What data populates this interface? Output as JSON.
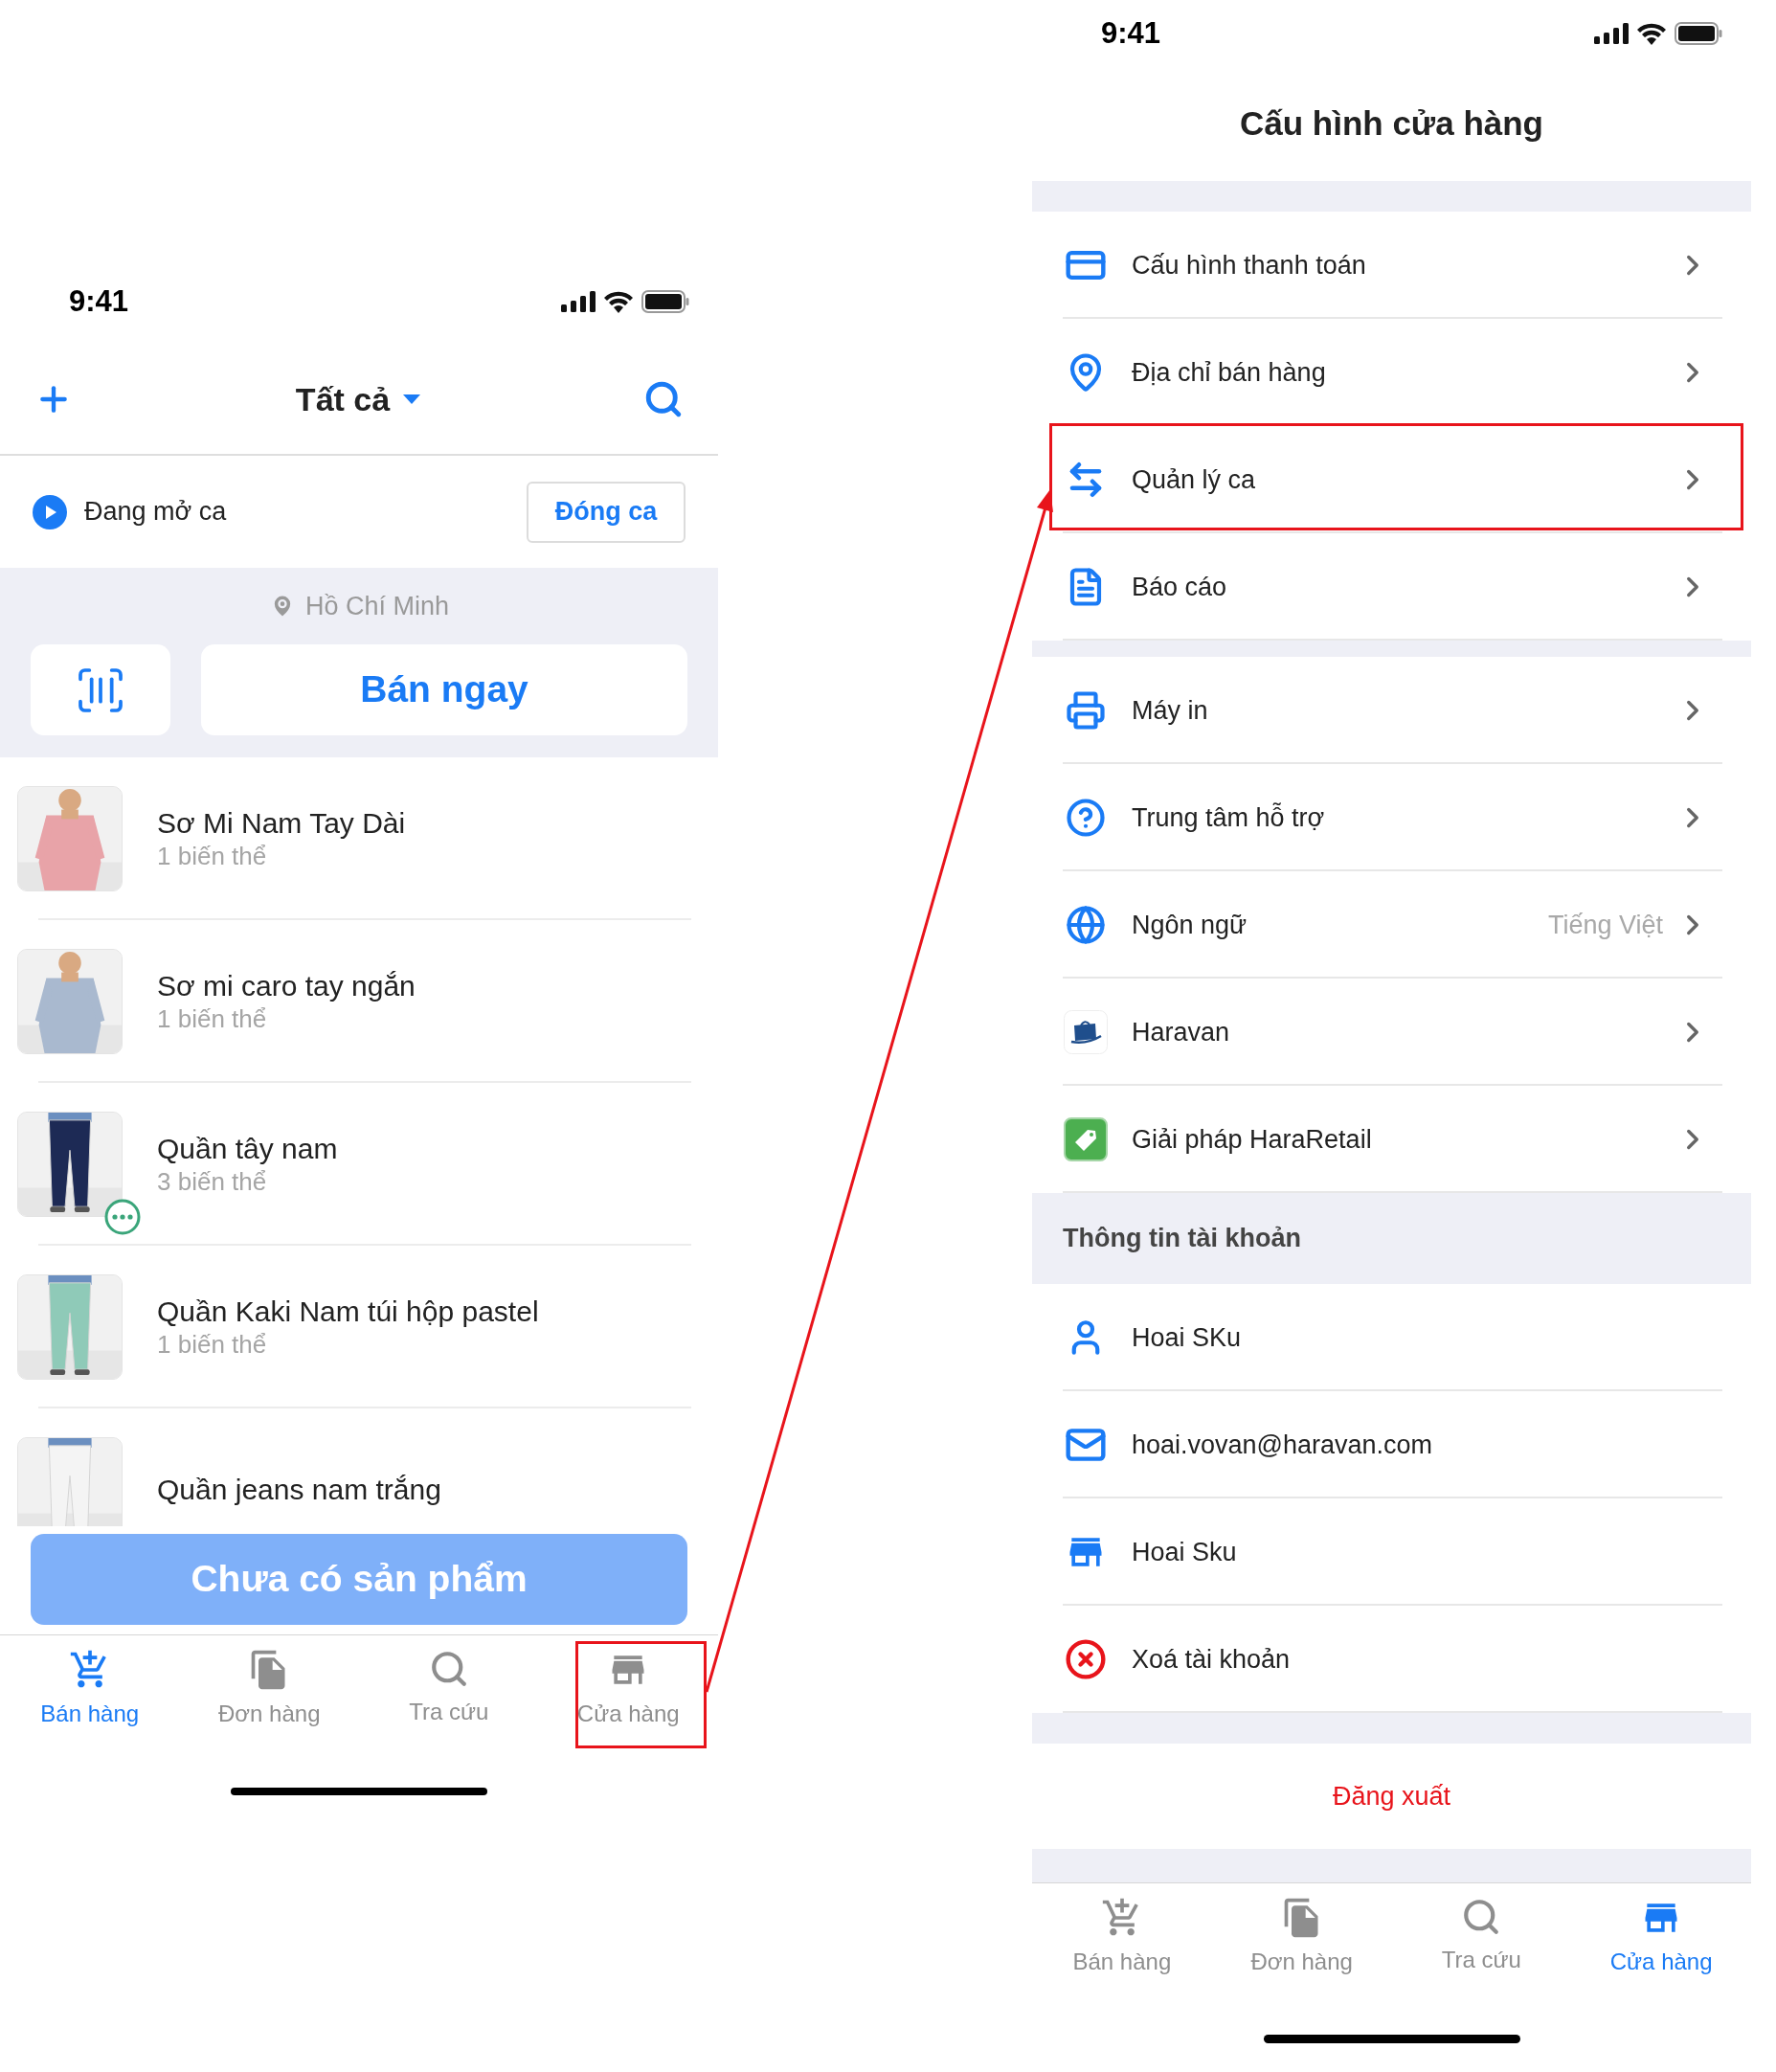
{
  "left": {
    "status_time": "9:41",
    "title": "Tất cả",
    "shift": {
      "status": "Đang mở ca",
      "button": "Đóng ca"
    },
    "location": "Hồ Chí Minh",
    "sell_button": "Bán ngay",
    "products": [
      {
        "name": "Sơ Mi Nam Tay Dài",
        "variants": "1 biến thể",
        "badge": false
      },
      {
        "name": "Sơ mi caro tay ngắn",
        "variants": "1 biến thể",
        "badge": false
      },
      {
        "name": "Quần tây nam",
        "variants": "3 biến thể",
        "badge": true
      },
      {
        "name": "Quần Kaki Nam túi hộp pastel",
        "variants": "1 biến thể",
        "badge": false
      },
      {
        "name": "Quần jeans nam trắng",
        "badge": false
      }
    ],
    "footer_button": {
      "label": "Chưa có sản phẩm",
      "disabled": true
    },
    "nav": [
      {
        "label": "Bán hàng",
        "selected": true,
        "highlighted": false
      },
      {
        "label": "Đơn hàng",
        "selected": false,
        "highlighted": false
      },
      {
        "label": "Tra cứu",
        "selected": false,
        "highlighted": false
      },
      {
        "label": "Cửa hàng",
        "selected": false,
        "highlighted": true
      }
    ]
  },
  "right": {
    "status_time": "9:41",
    "title": "Cấu hình cửa hàng",
    "groups": [
      {
        "items": [
          {
            "label": "Cấu hình thanh toán",
            "chevron": true,
            "highlighted": false
          },
          {
            "label": "Địa chỉ bán hàng",
            "chevron": true,
            "highlighted": false
          },
          {
            "label": "Quản lý ca",
            "chevron": true,
            "highlighted": true
          },
          {
            "label": "Báo cáo",
            "chevron": true,
            "highlighted": false
          }
        ]
      },
      {
        "items": [
          {
            "label": "Máy in",
            "chevron": true,
            "highlighted": false
          },
          {
            "label": "Trung tâm hỗ trợ",
            "chevron": true,
            "highlighted": false
          },
          {
            "label": "Ngôn ngữ",
            "value": "Tiếng Việt",
            "chevron": true,
            "highlighted": false
          },
          {
            "label": "Haravan",
            "chevron": true,
            "highlighted": false
          },
          {
            "label": "Giải pháp HaraRetail",
            "chevron": true,
            "highlighted": false
          }
        ]
      }
    ],
    "account": {
      "heading": "Thông tin tài khoản",
      "items": [
        {
          "label": "Hoai SKu",
          "chevron": false,
          "highlighted": false
        },
        {
          "label": "hoai.vovan@haravan.com",
          "chevron": false,
          "highlighted": false
        },
        {
          "label": "Hoai Sku",
          "chevron": false,
          "highlighted": false
        },
        {
          "label": "Xoá tài khoản",
          "chevron": false,
          "highlighted": false
        }
      ]
    },
    "logout": "Đăng xuất",
    "nav": [
      {
        "label": "Bán hàng",
        "selected": false
      },
      {
        "label": "Đơn hàng",
        "selected": false
      },
      {
        "label": "Tra cứu",
        "selected": false
      },
      {
        "label": "Cửa hàng",
        "selected": true
      }
    ]
  }
}
